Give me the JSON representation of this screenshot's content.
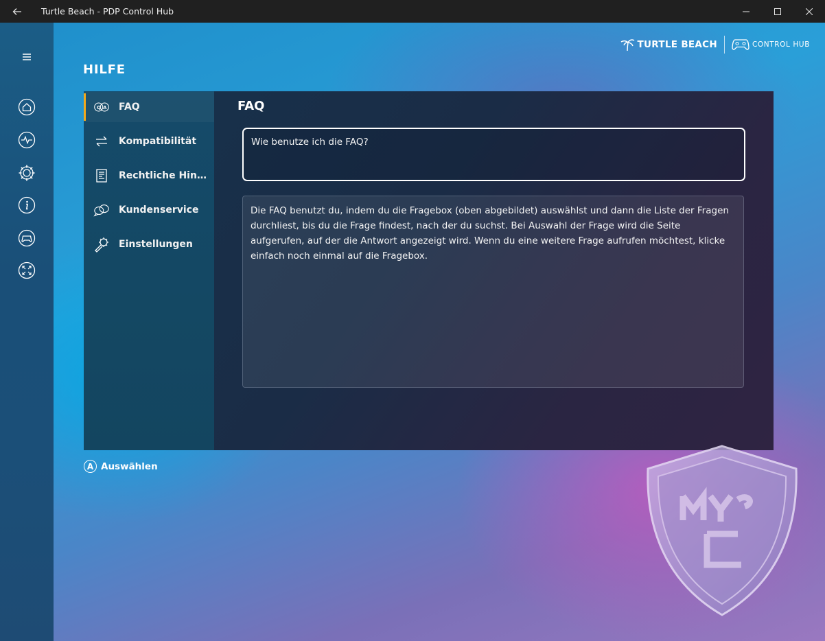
{
  "window": {
    "title": "Turtle Beach - PDP Control Hub",
    "back_icon": "back-arrow-icon"
  },
  "brand": {
    "name": "TURTLE BEACH",
    "product": "CONTROL HUB"
  },
  "nav": {
    "items": [
      {
        "id": "menu",
        "icon": "hamburger-icon"
      },
      {
        "id": "home",
        "icon": "home-icon"
      },
      {
        "id": "activity",
        "icon": "pulse-icon"
      },
      {
        "id": "settings",
        "icon": "gear-icon"
      },
      {
        "id": "info",
        "icon": "info-icon"
      },
      {
        "id": "controller",
        "icon": "gamepad-icon"
      },
      {
        "id": "fullscreen",
        "icon": "expand-icon"
      }
    ]
  },
  "page": {
    "title": "HILFE"
  },
  "sidemenu": {
    "items": [
      {
        "label": "FAQ",
        "icon": "faq-icon",
        "active": true
      },
      {
        "label": "Kompatibilität",
        "icon": "swap-arrows-icon",
        "active": false
      },
      {
        "label": "Rechtliche Hinweise",
        "icon": "document-icon",
        "active": false
      },
      {
        "label": "Kundenservice",
        "icon": "chat-bubbles-icon",
        "active": false
      },
      {
        "label": "Einstellungen",
        "icon": "wrench-gear-icon",
        "active": false
      }
    ]
  },
  "content": {
    "title": "FAQ",
    "question": "Wie benutze ich die FAQ?",
    "answer": "Die FAQ benutzt du, indem du die Fragebox (oben abgebildet) auswählst und dann die Liste der Fragen durchliest, bis du die Frage findest, nach der du suchst. Bei Auswahl der Frage wird die Seite aufgerufen, auf der die Antwort angezeigt wird. Wenn du eine weitere Frage aufrufen möchtest, klicke einfach noch einmal auf die Fragebox."
  },
  "hint": {
    "button": "A",
    "label": "Auswählen"
  },
  "colors": {
    "accent": "#f3a91a",
    "titlebar": "#202020",
    "nav_bg": "#1a4f78",
    "panel_bg": "#1a2c46"
  }
}
